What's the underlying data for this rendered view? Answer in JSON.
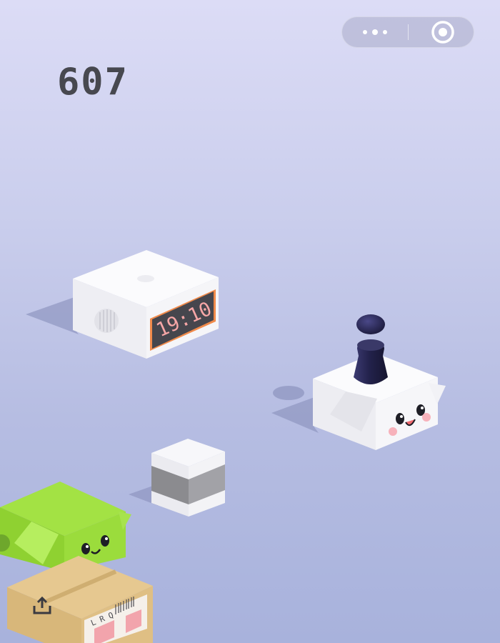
{
  "game": {
    "score": "607",
    "clock_display": "19:10",
    "parcel_label": "L R Q"
  },
  "capsule": {
    "more_icon": "more-dots-icon",
    "close_icon": "target-circle-icon"
  },
  "share_icon": "share-upload-icon",
  "colors": {
    "background_top": "#dcdcf6",
    "background_bottom": "#a8b2dc",
    "score_color": "#47484f",
    "player_color": "#2e2c5c",
    "green_block": "#a5e34a",
    "cardboard_box": "#e2c48c"
  }
}
